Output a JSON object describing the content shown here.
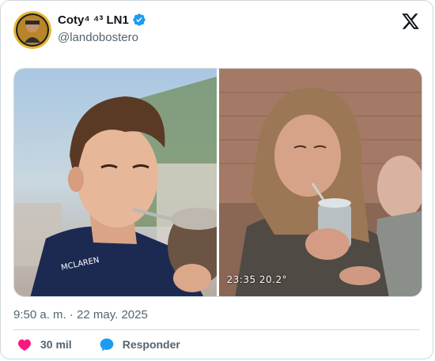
{
  "author": {
    "display_name": "Coty⁴ ⁴³ LN1",
    "handle": "@landobostero",
    "verified": true
  },
  "media": {
    "right_caption": "23:35  20.2°"
  },
  "timestamp": "9:50 a. m. · 22 may. 2025",
  "actions": {
    "likes_label": "30 mil",
    "reply_label": "Responder"
  },
  "colors": {
    "heart": "#f91880",
    "reply": "#1d9bf0",
    "verified": "#1d9bf0"
  },
  "icons": [
    "avatar",
    "verified-badge-icon",
    "x-logo-icon",
    "heart-icon",
    "reply-bubble-icon"
  ]
}
